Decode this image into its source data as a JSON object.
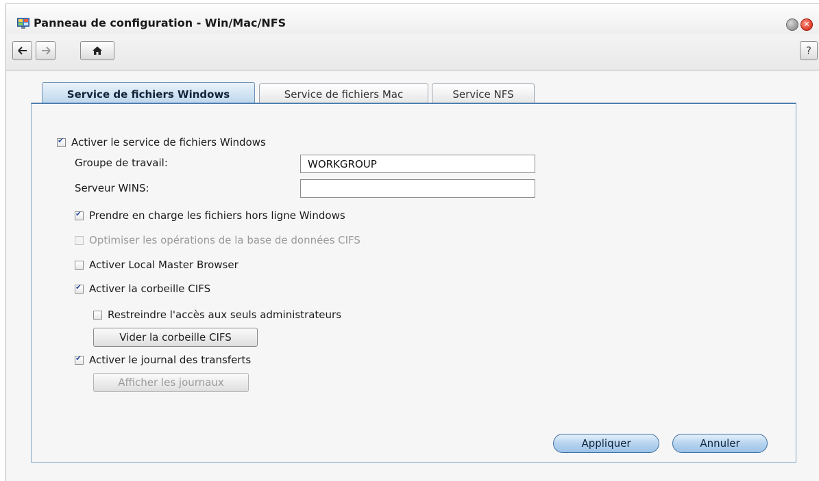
{
  "window": {
    "title": "Panneau de configuration - Win/Mac/NFS",
    "icons": {
      "app": "control-panel-icon",
      "minimize": "minimize-icon",
      "close": "close-icon"
    }
  },
  "toolbar": {
    "back": "arrow-left-icon",
    "forward": "arrow-right-icon",
    "home": "home-icon",
    "help": "?"
  },
  "tabs": [
    {
      "label": "Service de fichiers Windows",
      "active": true
    },
    {
      "label": "Service de fichiers Mac",
      "active": false
    },
    {
      "label": "Service NFS",
      "active": false
    }
  ],
  "form": {
    "enable_windows": {
      "label": "Activer le service de fichiers Windows",
      "checked": true
    },
    "workgroup": {
      "label": "Groupe de travail:",
      "value": "WORKGROUP"
    },
    "wins": {
      "label": "Serveur WINS:",
      "value": ""
    },
    "offline_files": {
      "label": "Prendre en charge les fichiers hors ligne Windows",
      "checked": true
    },
    "optimize_cifs": {
      "label": "Optimiser les opérations de la base de données CIFS",
      "checked": false,
      "disabled": true
    },
    "local_master": {
      "label": "Activer Local Master Browser",
      "checked": false
    },
    "recycle_bin": {
      "label": "Activer la corbeille CIFS",
      "checked": true
    },
    "restrict_admins": {
      "label": "Restreindre l'accès aux seuls administrateurs",
      "checked": false
    },
    "empty_recycle_button": "Vider la corbeille CIFS",
    "transfer_log": {
      "label": "Activer le journal des transferts",
      "checked": true
    },
    "show_logs_button": "Afficher les journaux"
  },
  "actions": {
    "apply": "Appliquer",
    "cancel": "Annuler"
  }
}
